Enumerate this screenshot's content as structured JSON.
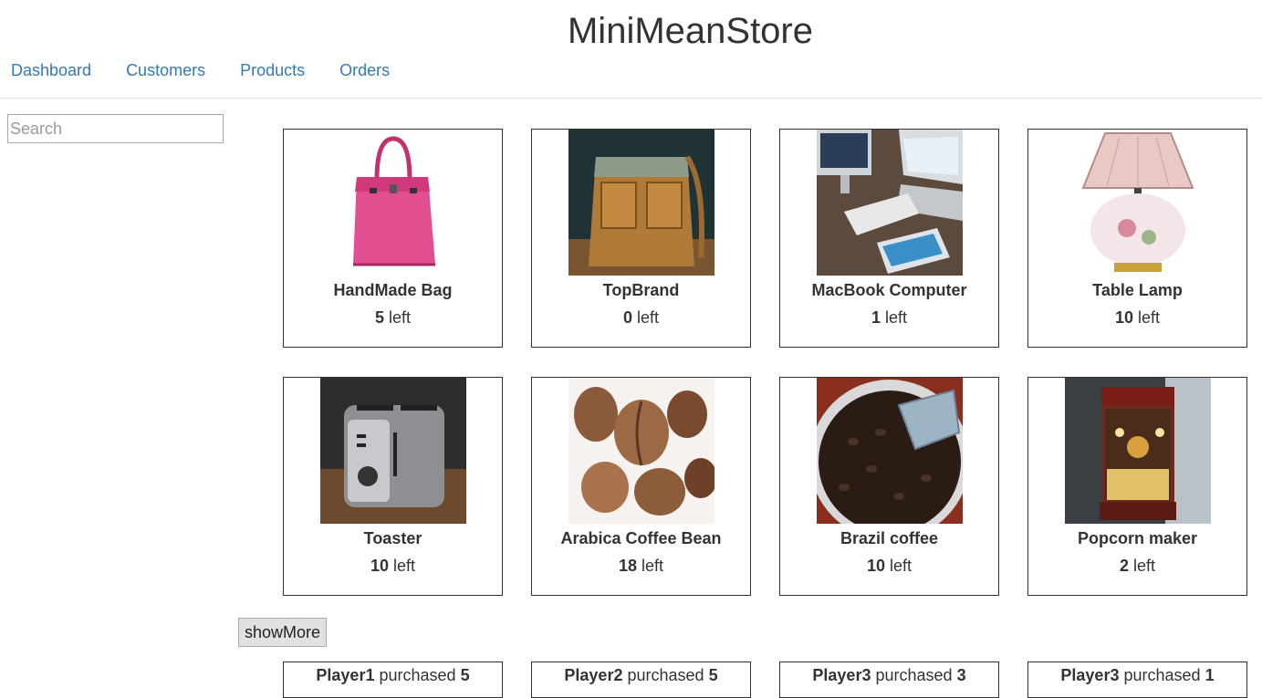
{
  "app": {
    "title": "MiniMeanStore"
  },
  "nav": {
    "items": [
      {
        "label": "Dashboard"
      },
      {
        "label": "Customers"
      },
      {
        "label": "Products"
      },
      {
        "label": "Orders"
      }
    ]
  },
  "search": {
    "placeholder": "Search",
    "value": ""
  },
  "products": [
    {
      "name": "HandMade Bag",
      "count": "5",
      "suffix": "left",
      "image": "pink-handbag"
    },
    {
      "name": "TopBrand",
      "count": "0",
      "suffix": "left",
      "image": "tan-leather-bag"
    },
    {
      "name": "MacBook Computer",
      "count": "1",
      "suffix": "left",
      "image": "desk-computers"
    },
    {
      "name": "Table Lamp",
      "count": "10",
      "suffix": "left",
      "image": "porcelain-lamp"
    },
    {
      "name": "Toaster",
      "count": "10",
      "suffix": "left",
      "image": "chrome-toaster"
    },
    {
      "name": "Arabica Coffee Bean",
      "count": "18",
      "suffix": "left",
      "image": "coffee-beans"
    },
    {
      "name": "Brazil coffee",
      "count": "10",
      "suffix": "left",
      "image": "coffee-scoop"
    },
    {
      "name": "Popcorn maker",
      "count": "2",
      "suffix": "left",
      "image": "popcorn-machine"
    }
  ],
  "show_more": {
    "label": "showMore"
  },
  "purchases": [
    {
      "player": "Player1",
      "verb": "purchased",
      "qty": "5"
    },
    {
      "player": "Player2",
      "verb": "purchased",
      "qty": "5"
    },
    {
      "player": "Player3",
      "verb": "purchased",
      "qty": "3"
    },
    {
      "player": "Player3",
      "verb": "purchased",
      "qty": "1"
    }
  ],
  "colors": {
    "link": "#337ab7",
    "text": "#333333",
    "border": "#333333"
  }
}
